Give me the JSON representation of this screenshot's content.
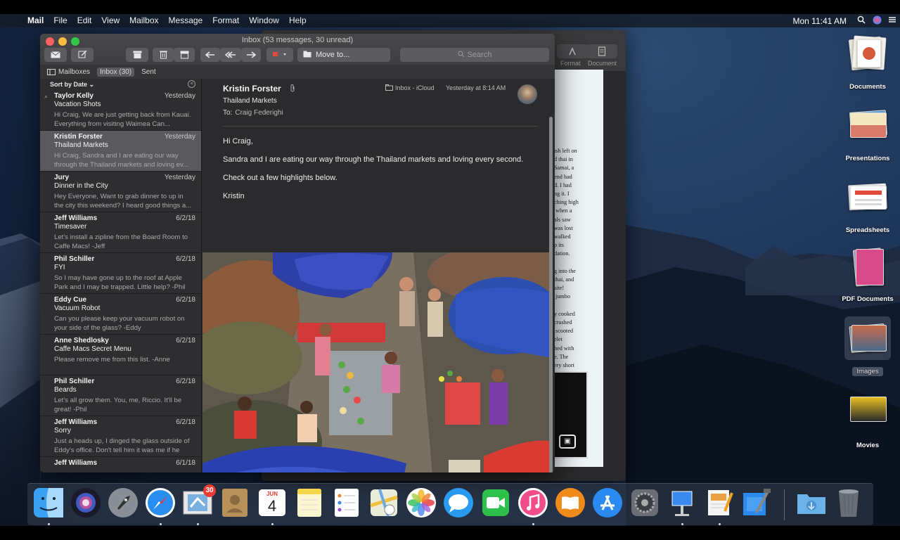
{
  "menubar": {
    "app_name": "Mail",
    "menus": [
      "File",
      "Edit",
      "View",
      "Mailbox",
      "Message",
      "Format",
      "Window",
      "Help"
    ],
    "clock": "Mon 11:41 AM",
    "status_icons": [
      "search-icon",
      "siri-icon",
      "control-icon"
    ]
  },
  "mail": {
    "window_title": "Inbox (53 messages, 30 unread)",
    "toolbar": {
      "move_to_label": "Move to...",
      "search_placeholder": "Search",
      "buttons": [
        "get-mail-icon",
        "compose-icon",
        "archive-icon",
        "delete-icon",
        "junk-icon",
        "reply-icon",
        "reply-all-icon",
        "forward-icon",
        "flag-icon"
      ]
    },
    "favorites": {
      "mailboxes": "Mailboxes",
      "inbox": "Inbox (30)",
      "sent": "Sent"
    },
    "sort_label": "Sort by Date",
    "messages": [
      {
        "sender": "Taylor Kelly",
        "date": "Yesterday",
        "subject": "Vacation Shots",
        "preview": "Hi Craig, We are just getting back from Kauai. Everything from visiting Waimea Can...",
        "attachment": true
      },
      {
        "sender": "Kristin Forster",
        "date": "Yesterday",
        "subject": "Thailand Markets",
        "preview": "Hi Craig, Sandra and I are eating our way through the Thailand markets and loving ev...",
        "selected": true
      },
      {
        "sender": "Jury",
        "date": "Yesterday",
        "subject": "Dinner in the City",
        "preview": "Hey Everyone, Want to grab dinner to up in the city this weekend? I heard good things a..."
      },
      {
        "sender": "Jeff Williams",
        "date": "6/2/18",
        "subject": "Timesaver",
        "preview": "Let's install a zipline from the Board Room to Caffe Macs! -Jeff"
      },
      {
        "sender": "Phil Schiller",
        "date": "6/2/18",
        "subject": "FYI",
        "preview": "So I may have gone up to the roof at Apple Park and I may be trapped. Little help? -Phil"
      },
      {
        "sender": "Eddy Cue",
        "date": "6/2/18",
        "subject": "Vacuum Robot",
        "preview": "Can you please keep your vacuum robot on your side of the glass? -Eddy"
      },
      {
        "sender": "Anne Shedlosky",
        "date": "6/2/18",
        "subject": "Caffe Macs Secret Menu",
        "preview": "Please remove me from this list. -Anne"
      },
      {
        "sender": "Phil Schiller",
        "date": "6/2/18",
        "subject": "Beards",
        "preview": "Let's all grow them. You, me, Riccio. It'll be great! -Phil"
      },
      {
        "sender": "Jeff Williams",
        "date": "6/2/18",
        "subject": "Sorry",
        "preview": "Just a heads up, I dinged the glass outside of Eddy's office. Don't tell him it was me if he"
      },
      {
        "sender": "Jeff Williams",
        "date": "6/1/18",
        "subject": "",
        "preview": ""
      }
    ],
    "reader": {
      "from": "Kristin Forster",
      "subject": "Thailand Markets",
      "to_label": "To:",
      "to": "Craig Federighi",
      "mailbox": "Inbox - iCloud",
      "time": "Yesterday at 8:14 AM",
      "body": [
        "Hi Craig,",
        "Sandra and I are eating our way through the Thailand markets and loving every second.",
        "Check out a few highlights below.",
        "Kristin"
      ]
    }
  },
  "doc_window": {
    "format_label": "Format",
    "document_label": "Document",
    "page_text": "ish left on\nd thai in\nSamai, a\nend had\nd. I had\nng it. I\nching high\n when a\nals saw\nwas lost\nwalked\np its\ndation.\n\ng into the\nthai, and\nsite!\n jumbo\n\ny cooked\ncrushed\n scooted\nelet\nhed with\ne. The\nery short"
  },
  "desktop_icons": [
    {
      "label": "Documents"
    },
    {
      "label": "Presentations"
    },
    {
      "label": "Spreadsheets"
    },
    {
      "label": "PDF Documents"
    },
    {
      "label": "Images"
    },
    {
      "label": "Movies"
    }
  ],
  "dock": {
    "apps": [
      "finder-icon",
      "siri-icon",
      "launchpad-icon",
      "safari-icon",
      "mail-icon",
      "contacts-icon",
      "calendar-icon",
      "notes-icon",
      "reminders-icon",
      "maps-icon",
      "photos-icon",
      "messages-icon",
      "facetime-icon",
      "itunes-icon",
      "books-icon",
      "app-store-icon",
      "system-preferences-icon",
      "keynote-icon",
      "pages-icon",
      "xcode-icon",
      "downloads-folder-icon",
      "trash-icon"
    ],
    "mail_badge": "30",
    "calendar_month": "JUN",
    "calendar_day": "4"
  },
  "colors": {
    "accent_red": "#ee3b33",
    "flag_red": "#e8453c",
    "selection_gray": "#5a5a5e",
    "window_dark": "#2b2b2d"
  }
}
